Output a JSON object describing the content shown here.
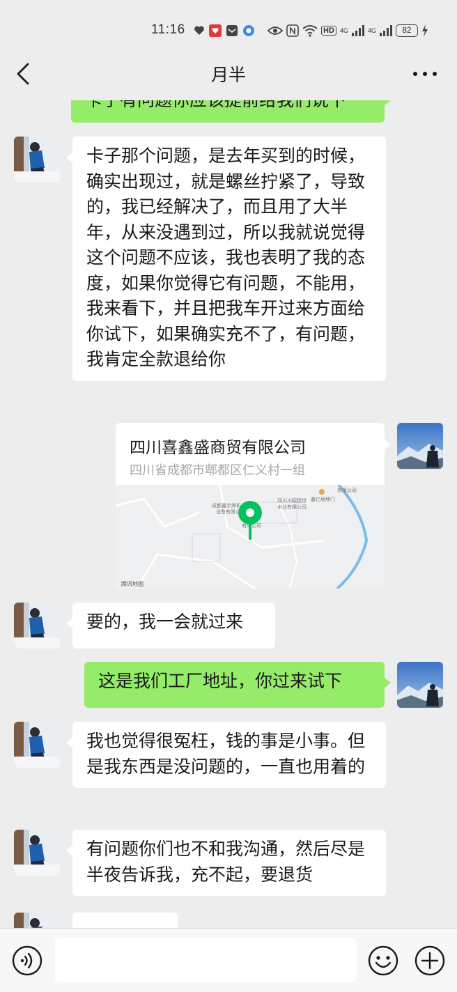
{
  "status_bar": {
    "time": "11:16",
    "network_1": "HD",
    "network_2": "4G",
    "network_3": "4G",
    "battery": "82"
  },
  "nav": {
    "title": "月半"
  },
  "messages": [
    {
      "side": "right",
      "type": "text",
      "text": "卡子有问题你应该提前给我们说下"
    },
    {
      "side": "left",
      "type": "text",
      "text": "卡子那个问题，是去年买到的时候，确实出现过，就是螺丝拧紧了，导致的，我已经解决了，而且用了大半年，从来没遇到过，所以我就说觉得这个问题不应该，我也表明了我的态度，如果你觉得它有问题，不能用，我来看下，并且把我车开过来方面给你试下，如果确实充不了，有问题，我肯定全款退给你"
    },
    {
      "side": "right",
      "type": "location",
      "title": "四川喜鑫盛商贸有限公司",
      "address": "四川省成都市郫都区仁义村一组",
      "map_labels": [
        "成都鑫宇婷机",
        "设备有限公",
        "四川川昭德世",
        "木业有限公司",
        "鑫亿居移门",
        "有限公司",
        "有限公司"
      ],
      "map_provider": "腾讯地图"
    },
    {
      "side": "left",
      "type": "text",
      "text": "要的，我一会就过来"
    },
    {
      "side": "right",
      "type": "text",
      "text": "这是我们工厂地址，你过来试下"
    },
    {
      "side": "left",
      "type": "text",
      "text": "我也觉得很冤枉，钱的事是小事。但是我东西是没问题的，一直也用着的"
    },
    {
      "side": "left",
      "type": "text",
      "text": "有问题你们也不和我沟通，然后尽是半夜告诉我，充不起，要退货"
    },
    {
      "side": "left",
      "type": "text",
      "text": "…"
    }
  ],
  "input": {
    "value": "",
    "placeholder": ""
  },
  "colors": {
    "background": "#ededed",
    "bubble_self": "#95ec69",
    "bubble_other": "#ffffff",
    "map_pin": "#07c160"
  }
}
